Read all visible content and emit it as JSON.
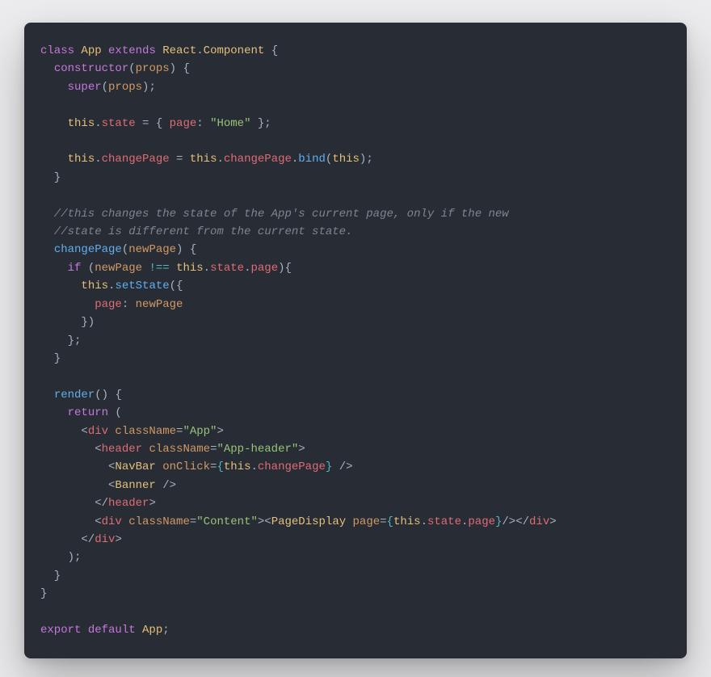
{
  "code": {
    "line1": {
      "a": "class ",
      "b": "App ",
      "c": "extends ",
      "d": "React",
      "e": ".",
      "f": "Component ",
      "g": "{"
    },
    "line2": {
      "a": "  ",
      "b": "constructor",
      "c": "(",
      "d": "props",
      "e": ") {"
    },
    "line3": {
      "a": "    ",
      "b": "super",
      "c": "(",
      "d": "props",
      "e": ");"
    },
    "line4": {
      "a": ""
    },
    "line5": {
      "a": "    ",
      "b": "this",
      "c": ".",
      "d": "state",
      "e": " = { ",
      "f": "page",
      "g": ": ",
      "h": "\"Home\"",
      "i": " };"
    },
    "line6": {
      "a": ""
    },
    "line7": {
      "a": "    ",
      "b": "this",
      "c": ".",
      "d": "changePage",
      "e": " = ",
      "f": "this",
      "g": ".",
      "h": "changePage",
      "i": ".",
      "j": "bind",
      "k": "(",
      "l": "this",
      "m": ");"
    },
    "line8": {
      "a": "  }"
    },
    "line9": {
      "a": ""
    },
    "line10": {
      "a": "  //this changes the state of the App's current page, only if the new"
    },
    "line11": {
      "a": "  //state is different from the current state."
    },
    "line12": {
      "a": "  ",
      "b": "changePage",
      "c": "(",
      "d": "newPage",
      "e": ") {"
    },
    "line13": {
      "a": "    ",
      "b": "if ",
      "c": "(",
      "d": "newPage ",
      "e": "!== ",
      "f": "this",
      "g": ".",
      "h": "state",
      "i": ".",
      "j": "page",
      "k": "){"
    },
    "line14": {
      "a": "      ",
      "b": "this",
      "c": ".",
      "d": "setState",
      "e": "({"
    },
    "line15": {
      "a": "        ",
      "b": "page",
      "c": ": ",
      "d": "newPage"
    },
    "line16": {
      "a": "      })"
    },
    "line17": {
      "a": "    };"
    },
    "line18": {
      "a": "  }"
    },
    "line19": {
      "a": ""
    },
    "line20": {
      "a": "  ",
      "b": "render",
      "c": "() {"
    },
    "line21": {
      "a": "    ",
      "b": "return ",
      "c": "("
    },
    "line22": {
      "a": "      <",
      "b": "div ",
      "c": "className",
      "d": "=",
      "e": "\"App\"",
      "f": ">"
    },
    "line23": {
      "a": "        <",
      "b": "header ",
      "c": "className",
      "d": "=",
      "e": "\"App-header\"",
      "f": ">"
    },
    "line24": {
      "a": "          <",
      "b": "NavBar ",
      "c": "onClick",
      "d": "=",
      "e": "{",
      "f": "this",
      "g": ".",
      "h": "changePage",
      "i": "}",
      "j": " />"
    },
    "line25": {
      "a": "          <",
      "b": "Banner ",
      "c": "/>"
    },
    "line26": {
      "a": "        </",
      "b": "header",
      "c": ">"
    },
    "line27": {
      "a": "        <",
      "b": "div ",
      "c": "className",
      "d": "=",
      "e": "\"Content\"",
      "f": "><",
      "g": "PageDisplay ",
      "h": "page",
      "i": "=",
      "j": "{",
      "k": "this",
      "l": ".",
      "m": "state",
      "n": ".",
      "o": "page",
      "p": "}",
      "q": "/></",
      "r": "div",
      "s": ">"
    },
    "line28": {
      "a": "      </",
      "b": "div",
      "c": ">"
    },
    "line29": {
      "a": "    );"
    },
    "line30": {
      "a": "  }"
    },
    "line31": {
      "a": "}"
    },
    "line32": {
      "a": ""
    },
    "line33": {
      "a": "export ",
      "b": "default ",
      "c": "App",
      "d": ";"
    }
  }
}
